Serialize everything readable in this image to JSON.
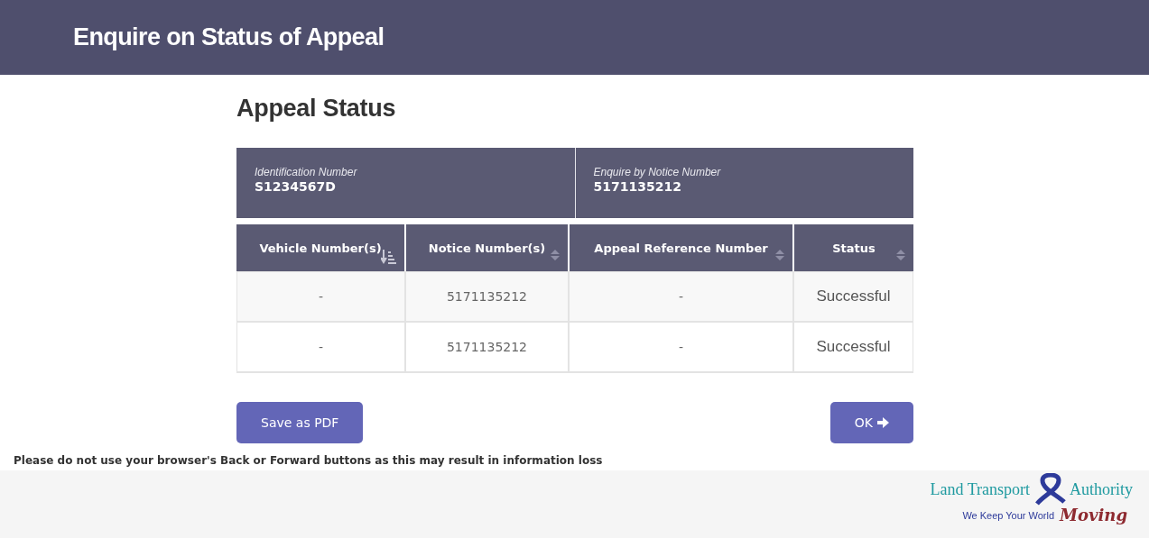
{
  "header": {
    "title": "Enquire on Status of Appeal"
  },
  "page_heading": "Appeal Status",
  "summary": [
    {
      "label": "Identification Number",
      "value": "S1234567D"
    },
    {
      "label": "Enquire by Notice Number",
      "value": "5171135212"
    }
  ],
  "table": {
    "columns": [
      {
        "label": "Vehicle Number(s)",
        "kind": "sorted"
      },
      {
        "label": "Notice Number(s)",
        "kind": "sortable"
      },
      {
        "label": "Appeal Reference Number",
        "kind": "sortable"
      },
      {
        "label": "Status",
        "kind": "sortable"
      }
    ],
    "rows": [
      [
        "-",
        "5171135212",
        "-",
        "Successful"
      ],
      [
        "-",
        "5171135212",
        "-",
        "Successful"
      ]
    ]
  },
  "buttons": [
    {
      "label": "Save as PDF",
      "kind": "plain"
    },
    {
      "label": "OK",
      "kind": "next"
    }
  ],
  "notice": "Please do not use your browser's Back or Forward buttons as this may result in information loss",
  "logo": {
    "name_left": "Land Transport",
    "name_right": "Authority",
    "tagline": "We Keep Your World",
    "tagline_script": "Moving"
  }
}
